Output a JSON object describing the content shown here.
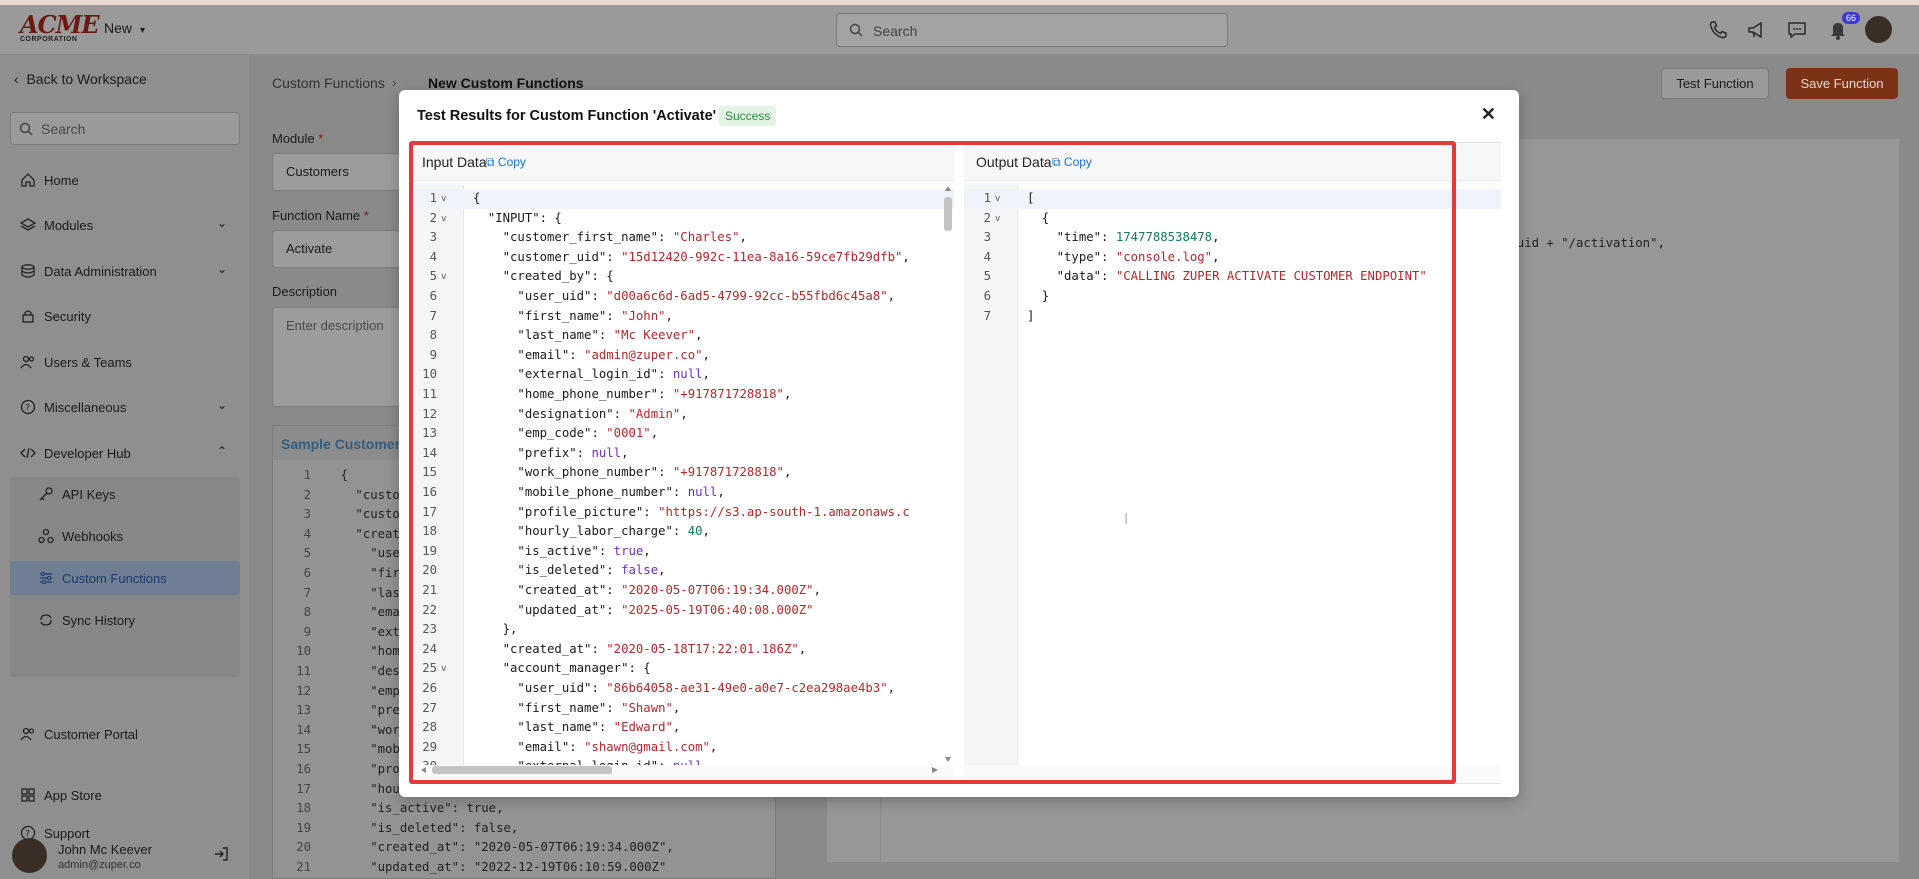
{
  "topbar": {
    "logo_main": "ACME",
    "logo_sub": "CORPORATION",
    "new_label": "New",
    "search_placeholder": "Search",
    "notification_count": "66"
  },
  "sidebar": {
    "back_label": "Back to Workspace",
    "search_placeholder": "Search",
    "items": [
      {
        "label": "Home",
        "icon": "home-icon"
      },
      {
        "label": "Modules",
        "icon": "layers-icon"
      },
      {
        "label": "Data Administration",
        "icon": "database-icon"
      },
      {
        "label": "Security",
        "icon": "lock-icon"
      },
      {
        "label": "Users & Teams",
        "icon": "users-icon"
      },
      {
        "label": "Miscellaneous",
        "icon": "help-circle-icon"
      },
      {
        "label": "Developer Hub",
        "icon": "code-icon"
      },
      {
        "label": "API Keys",
        "icon": "key-icon"
      },
      {
        "label": "Webhooks",
        "icon": "webhook-icon"
      },
      {
        "label": "Custom Functions",
        "icon": "sliders-icon"
      },
      {
        "label": "Sync History",
        "icon": "sync-icon"
      },
      {
        "label": "Customer Portal",
        "icon": "users-icon"
      },
      {
        "label": "App Store",
        "icon": "grid-icon"
      },
      {
        "label": "Support",
        "icon": "help-circle-icon"
      }
    ],
    "user": {
      "name": "John Mc Keever",
      "email": "admin@zuper.co"
    }
  },
  "main": {
    "breadcrumb_parent": "Custom Functions",
    "breadcrumb_current": "New Custom Functions",
    "test_button": "Test Function",
    "save_button": "Save Function",
    "module_label": "Module",
    "module_value": "Customers",
    "function_name_label": "Function Name",
    "function_name_value": "Activate",
    "description_label": "Description",
    "description_placeholder": "Enter description",
    "sample_header": "Sample Customer",
    "sample_lines": [
      {
        "n": "1",
        "t": "{"
      },
      {
        "n": "2",
        "t": "  \"custo"
      },
      {
        "n": "3",
        "t": "  \"custo"
      },
      {
        "n": "4",
        "t": "  \"creat"
      },
      {
        "n": "5",
        "t": "    \"use"
      },
      {
        "n": "6",
        "t": "    \"fir"
      },
      {
        "n": "7",
        "t": "    \"las"
      },
      {
        "n": "8",
        "t": "    \"ema"
      },
      {
        "n": "9",
        "t": "    \"ext"
      },
      {
        "n": "10",
        "t": "    \"hom"
      },
      {
        "n": "11",
        "t": "    \"des"
      },
      {
        "n": "12",
        "t": "    \"emp"
      },
      {
        "n": "13",
        "t": "    \"pre"
      },
      {
        "n": "14",
        "t": "    \"wor"
      },
      {
        "n": "15",
        "t": "    \"mob"
      },
      {
        "n": "16",
        "t": "    \"pro"
      },
      {
        "n": "17",
        "t": "    \"hou"
      },
      {
        "n": "18",
        "t": "    \"is_active\": true,"
      },
      {
        "n": "19",
        "t": "    \"is_deleted\": false,"
      },
      {
        "n": "20",
        "t": "    \"created_at\": \"2020-05-07T06:19:34.000Z\","
      },
      {
        "n": "21",
        "t": "    \"updated_at\": \"2022-12-19T06:10:59.000Z\""
      }
    ],
    "right_code_fragment": "r_uid + \"/activation\","
  },
  "modal": {
    "title": "Test Results for Custom Function 'Activate'",
    "status": "Success",
    "input_title": "Input Data",
    "output_title": "Output Data",
    "copy_label": "Copy",
    "input_lines": [
      {
        "n": "1",
        "f": true,
        "seg": [
          [
            "k",
            "{"
          ]
        ]
      },
      {
        "n": "2",
        "f": true,
        "seg": [
          [
            "k",
            "  \"INPUT\": {"
          ]
        ]
      },
      {
        "n": "3",
        "seg": [
          [
            "k",
            "    \"customer_first_name\": "
          ],
          [
            "s",
            "\"Charles\""
          ],
          [
            "k",
            ","
          ]
        ]
      },
      {
        "n": "4",
        "seg": [
          [
            "k",
            "    \"customer_uid\": "
          ],
          [
            "s",
            "\"15d12420-992c-11ea-8a16-59ce7fb29dfb\""
          ],
          [
            "k",
            ","
          ]
        ]
      },
      {
        "n": "5",
        "f": true,
        "seg": [
          [
            "k",
            "    \"created_by\": {"
          ]
        ]
      },
      {
        "n": "6",
        "seg": [
          [
            "k",
            "      \"user_uid\": "
          ],
          [
            "s",
            "\"d00a6c6d-6ad5-4799-92cc-b55fbd6c45a8\""
          ],
          [
            "k",
            ","
          ]
        ]
      },
      {
        "n": "7",
        "seg": [
          [
            "k",
            "      \"first_name\": "
          ],
          [
            "s",
            "\"John\""
          ],
          [
            "k",
            ","
          ]
        ]
      },
      {
        "n": "8",
        "seg": [
          [
            "k",
            "      \"last_name\": "
          ],
          [
            "s",
            "\"Mc Keever\""
          ],
          [
            "k",
            ","
          ]
        ]
      },
      {
        "n": "9",
        "seg": [
          [
            "k",
            "      \"email\": "
          ],
          [
            "s",
            "\"admin@zuper.co\""
          ],
          [
            "k",
            ","
          ]
        ]
      },
      {
        "n": "10",
        "seg": [
          [
            "k",
            "      \"external_login_id\": "
          ],
          [
            "kw",
            "null"
          ],
          [
            "k",
            ","
          ]
        ]
      },
      {
        "n": "11",
        "seg": [
          [
            "k",
            "      \"home_phone_number\": "
          ],
          [
            "s",
            "\"+917871728818\""
          ],
          [
            "k",
            ","
          ]
        ]
      },
      {
        "n": "12",
        "seg": [
          [
            "k",
            "      \"designation\": "
          ],
          [
            "s",
            "\"Admin\""
          ],
          [
            "k",
            ","
          ]
        ]
      },
      {
        "n": "13",
        "seg": [
          [
            "k",
            "      \"emp_code\": "
          ],
          [
            "s",
            "\"0001\""
          ],
          [
            "k",
            ","
          ]
        ]
      },
      {
        "n": "14",
        "seg": [
          [
            "k",
            "      \"prefix\": "
          ],
          [
            "kw",
            "null"
          ],
          [
            "k",
            ","
          ]
        ]
      },
      {
        "n": "15",
        "seg": [
          [
            "k",
            "      \"work_phone_number\": "
          ],
          [
            "s",
            "\"+917871728818\""
          ],
          [
            "k",
            ","
          ]
        ]
      },
      {
        "n": "16",
        "seg": [
          [
            "k",
            "      \"mobile_phone_number\": "
          ],
          [
            "kw",
            "null"
          ],
          [
            "k",
            ","
          ]
        ]
      },
      {
        "n": "17",
        "seg": [
          [
            "k",
            "      \"profile_picture\": "
          ],
          [
            "s",
            "\"https://s3.ap-south-1.amazonaws.c"
          ]
        ]
      },
      {
        "n": "18",
        "seg": [
          [
            "k",
            "      \"hourly_labor_charge\": "
          ],
          [
            "num",
            "40"
          ],
          [
            "k",
            ","
          ]
        ]
      },
      {
        "n": "19",
        "seg": [
          [
            "k",
            "      \"is_active\": "
          ],
          [
            "kw",
            "true"
          ],
          [
            "k",
            ","
          ]
        ]
      },
      {
        "n": "20",
        "seg": [
          [
            "k",
            "      \"is_deleted\": "
          ],
          [
            "kw",
            "false"
          ],
          [
            "k",
            ","
          ]
        ]
      },
      {
        "n": "21",
        "seg": [
          [
            "k",
            "      \"created_at\": "
          ],
          [
            "s",
            "\"2020-05-07T06:19:34.000Z\""
          ],
          [
            "k",
            ","
          ]
        ]
      },
      {
        "n": "22",
        "seg": [
          [
            "k",
            "      \"updated_at\": "
          ],
          [
            "s",
            "\"2025-05-19T06:40:08.000Z\""
          ]
        ]
      },
      {
        "n": "23",
        "seg": [
          [
            "k",
            "    },"
          ]
        ]
      },
      {
        "n": "24",
        "seg": [
          [
            "k",
            "    \"created_at\": "
          ],
          [
            "s",
            "\"2020-05-18T17:22:01.186Z\""
          ],
          [
            "k",
            ","
          ]
        ]
      },
      {
        "n": "25",
        "f": true,
        "seg": [
          [
            "k",
            "    \"account_manager\": {"
          ]
        ]
      },
      {
        "n": "26",
        "seg": [
          [
            "k",
            "      \"user_uid\": "
          ],
          [
            "s",
            "\"86b64058-ae31-49e0-a0e7-c2ea298ae4b3\""
          ],
          [
            "k",
            ","
          ]
        ]
      },
      {
        "n": "27",
        "seg": [
          [
            "k",
            "      \"first_name\": "
          ],
          [
            "s",
            "\"Shawn\""
          ],
          [
            "k",
            ","
          ]
        ]
      },
      {
        "n": "28",
        "seg": [
          [
            "k",
            "      \"last_name\": "
          ],
          [
            "s",
            "\"Edward\""
          ],
          [
            "k",
            ","
          ]
        ]
      },
      {
        "n": "29",
        "seg": [
          [
            "k",
            "      \"email\": "
          ],
          [
            "s",
            "\"shawn@gmail.com\""
          ],
          [
            "k",
            ","
          ]
        ]
      },
      {
        "n": "30",
        "seg": [
          [
            "k",
            "      \"external_login_id\": "
          ],
          [
            "kw",
            "null"
          ]
        ]
      }
    ],
    "output_lines": [
      {
        "n": "1",
        "f": true,
        "seg": [
          [
            "k",
            "["
          ]
        ]
      },
      {
        "n": "2",
        "f": true,
        "seg": [
          [
            "k",
            "  {"
          ]
        ]
      },
      {
        "n": "3",
        "seg": [
          [
            "k",
            "    \"time\": "
          ],
          [
            "num",
            "1747788538478"
          ],
          [
            "k",
            ","
          ]
        ]
      },
      {
        "n": "4",
        "seg": [
          [
            "k",
            "    \"type\": "
          ],
          [
            "s",
            "\"console.log\""
          ],
          [
            "k",
            ","
          ]
        ]
      },
      {
        "n": "5",
        "seg": [
          [
            "k",
            "    \"data\": "
          ],
          [
            "s",
            "\"CALLING ZUPER ACTIVATE CUSTOMER ENDPOINT\""
          ]
        ]
      },
      {
        "n": "6",
        "seg": [
          [
            "k",
            "  }"
          ]
        ]
      },
      {
        "n": "7",
        "seg": [
          [
            "k",
            "]"
          ]
        ]
      }
    ]
  }
}
